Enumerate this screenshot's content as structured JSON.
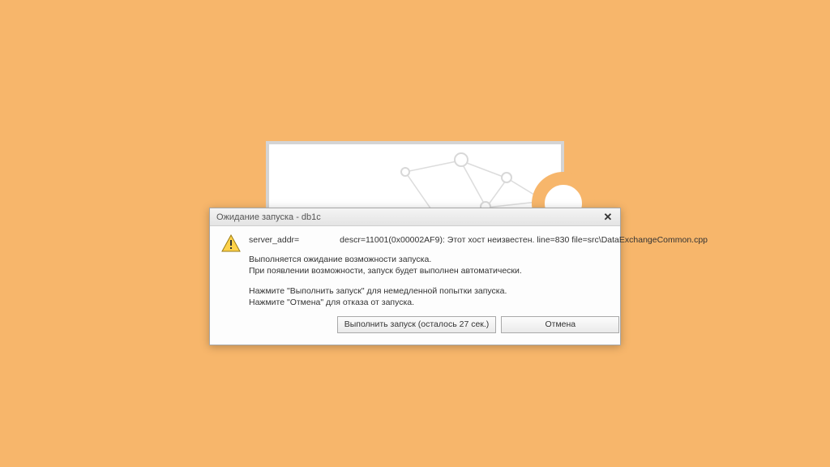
{
  "dialog": {
    "title": "Ожидание запуска - db1c",
    "error_prefix": "server_addr=",
    "error_suffix": "descr=11001(0x00002AF9): Этот хост неизвестен.   line=830 file=src\\DataExchangeCommon.cpp",
    "para1_line1": "Выполняется ожидание возможности запуска.",
    "para1_line2": "При появлении возможности, запуск будет выполнен автоматически.",
    "para2_line1": "Нажмите \"Выполнить запуск\" для немедленной попытки запуска.",
    "para2_line2": "Нажмите \"Отмена\" для отказа от запуска.",
    "retry_button": "Выполнить запуск (осталось 27 сек.)",
    "cancel_button": "Отмена"
  }
}
